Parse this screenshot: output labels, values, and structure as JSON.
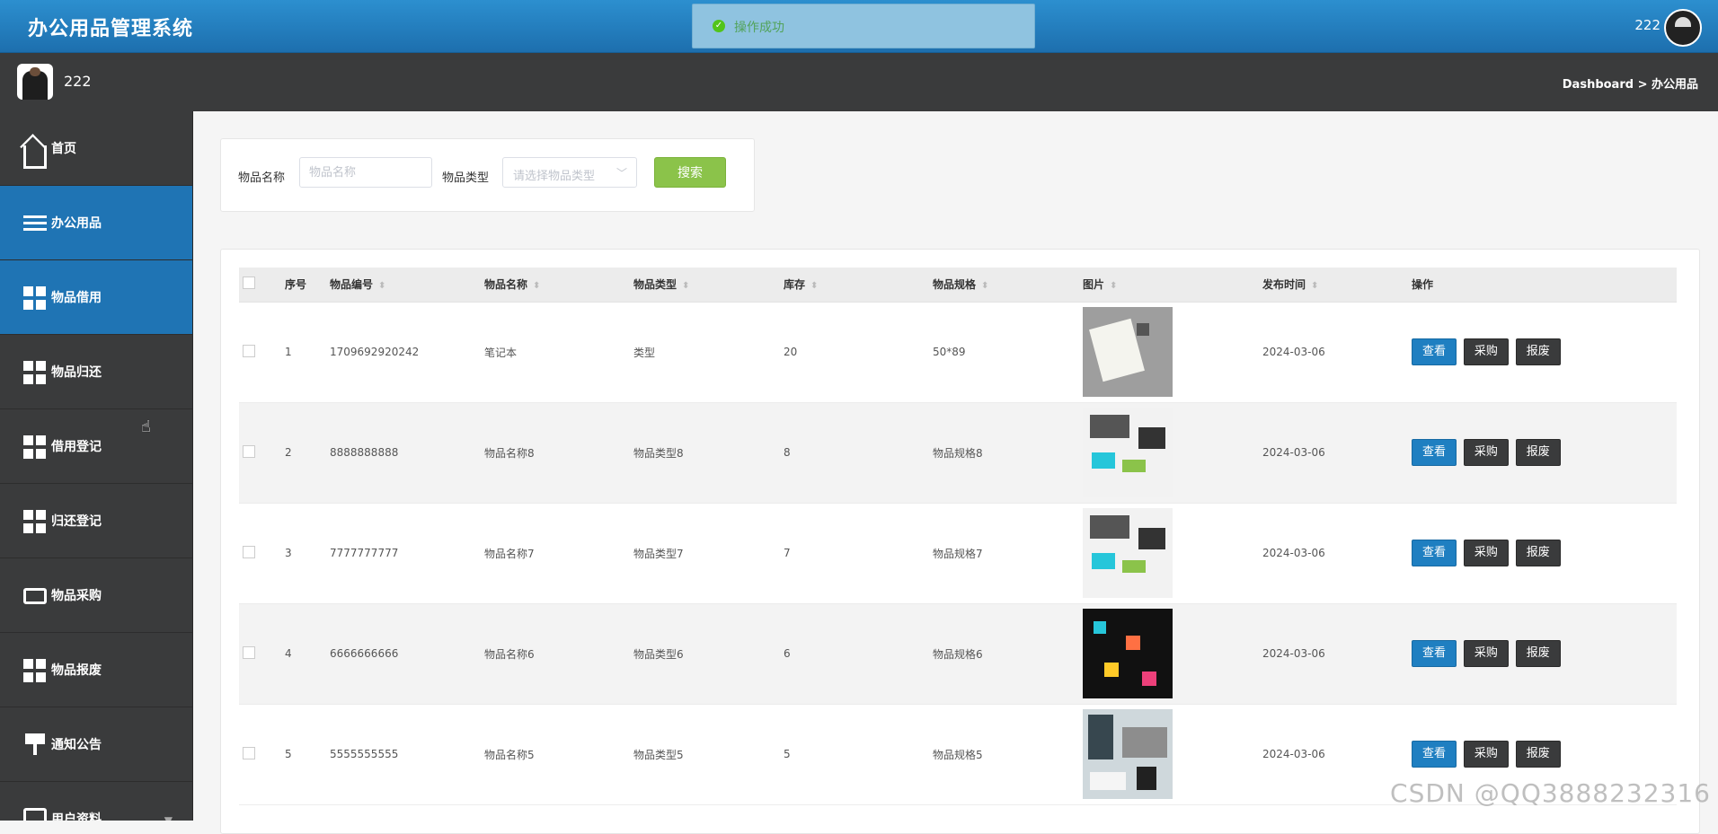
{
  "app": {
    "title": "办公用品管理系统",
    "user": "222"
  },
  "toast": {
    "message": "操作成功",
    "icon": "check-circle-icon",
    "color": "#52c41a"
  },
  "subbar": {
    "username": "222",
    "breadcrumb": "Dashboard > 办公用品"
  },
  "sidebar": {
    "items": [
      {
        "label": "首页",
        "icon": "home-icon"
      },
      {
        "label": "办公用品",
        "icon": "sliders-icon"
      },
      {
        "label": "物品借用",
        "icon": "grid-icon"
      },
      {
        "label": "物品归还",
        "icon": "grid-icon"
      },
      {
        "label": "借用登记",
        "icon": "grid-icon"
      },
      {
        "label": "归还登记",
        "icon": "grid-icon"
      },
      {
        "label": "物品采购",
        "icon": "wallet-icon"
      },
      {
        "label": "物品报废",
        "icon": "grid-icon"
      },
      {
        "label": "通知公告",
        "icon": "pin-icon"
      },
      {
        "label": "用户资料",
        "icon": "card-icon"
      }
    ]
  },
  "search": {
    "name_label": "物品名称",
    "name_placeholder": "物品名称",
    "type_label": "物品类型",
    "type_placeholder": "请选择物品类型",
    "button": "搜索"
  },
  "table": {
    "headers": {
      "index": "序号",
      "code": "物品编号",
      "name": "物品名称",
      "type": "物品类型",
      "stock": "库存",
      "spec": "物品规格",
      "image": "图片",
      "date": "发布时间",
      "ops": "操作"
    },
    "actions": {
      "view": "查看",
      "buy": "采购",
      "scrap": "报废"
    },
    "rows": [
      {
        "index": "1",
        "code": "1709692920242",
        "name": "笔记本",
        "type": "类型",
        "stock": "20",
        "spec": "50*89",
        "date": "2024-03-06"
      },
      {
        "index": "2",
        "code": "8888888888",
        "name": "物品名称8",
        "type": "物品类型8",
        "stock": "8",
        "spec": "物品规格8",
        "date": "2024-03-06"
      },
      {
        "index": "3",
        "code": "7777777777",
        "name": "物品名称7",
        "type": "物品类型7",
        "stock": "7",
        "spec": "物品规格7",
        "date": "2024-03-06"
      },
      {
        "index": "4",
        "code": "6666666666",
        "name": "物品名称6",
        "type": "物品类型6",
        "stock": "6",
        "spec": "物品规格6",
        "date": "2024-03-06"
      },
      {
        "index": "5",
        "code": "5555555555",
        "name": "物品名称5",
        "type": "物品类型5",
        "stock": "5",
        "spec": "物品规格5",
        "date": "2024-03-06"
      }
    ]
  },
  "watermark": "CSDN @QQ3888232316",
  "colors": {
    "primary": "#1f74b4",
    "sidebar": "#3a3b3c",
    "search_button": "#8bc34a"
  }
}
